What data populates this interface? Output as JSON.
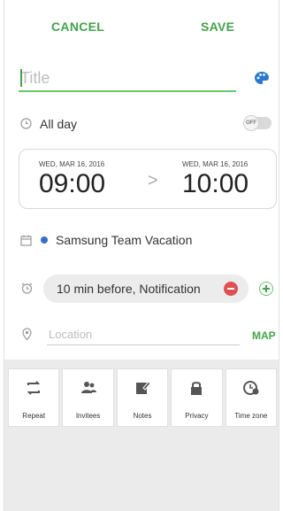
{
  "toolbar": {
    "cancel_label": "CANCEL",
    "save_label": "SAVE"
  },
  "title_field": {
    "placeholder": "Title",
    "value": ""
  },
  "all_day": {
    "label": "All day",
    "toggle_state": "OFF"
  },
  "time": {
    "start_date": "WED, MAR 16, 2016",
    "start_time": "09:00",
    "arrow": ">",
    "end_date": "WED, MAR 16, 2016",
    "end_time": "10:00"
  },
  "calendar": {
    "name": "Samsung Team Vacation",
    "dot_color": "#2f6fcf"
  },
  "reminder": {
    "text": "10 min before, Notification"
  },
  "location": {
    "placeholder": "Location",
    "map_label": "MAP"
  },
  "options": [
    {
      "label": "Repeat",
      "icon": "repeat-icon"
    },
    {
      "label": "Invitees",
      "icon": "invitees-icon"
    },
    {
      "label": "Notes",
      "icon": "notes-icon"
    },
    {
      "label": "Privacy",
      "icon": "lock-icon"
    },
    {
      "label": "Time zone",
      "icon": "timezone-icon"
    }
  ],
  "colors": {
    "accent": "#3fa648",
    "remove": "#e05050",
    "palette": "#2a78d4"
  }
}
